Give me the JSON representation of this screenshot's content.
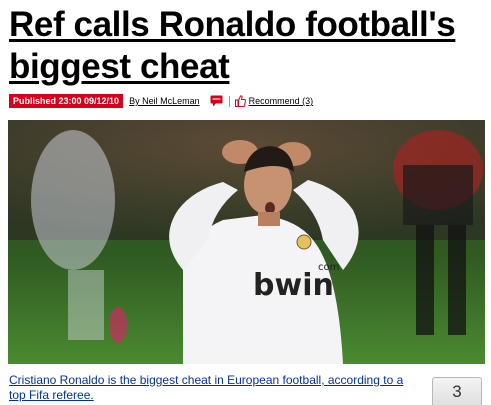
{
  "article": {
    "headline": "Ref calls Ronaldo football's biggest cheat",
    "published": "Published 23:00 09/12/10",
    "author": "By Neil McLeman",
    "recommend": "Recommend (3)",
    "caption": "Cristiano Ronaldo is the biggest cheat in European football, according to a top Fifa referee.",
    "count": "3"
  },
  "photo": {
    "jersey_text": "bwin",
    "jersey_sup": "com"
  },
  "icons": {
    "comment": "speech-bubble-icon",
    "recommend": "thumbs-up-icon"
  },
  "colors": {
    "published_bg": "#d6001c",
    "caption_link": "#003399"
  }
}
